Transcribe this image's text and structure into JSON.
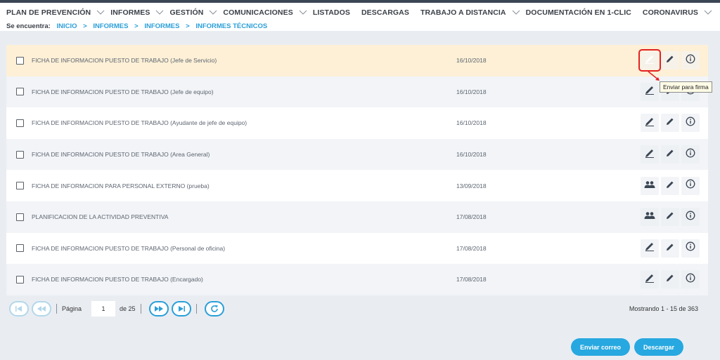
{
  "nav": {
    "items": [
      {
        "label": "PLAN DE PREVENCIÓN",
        "dropdown": true
      },
      {
        "label": "INFORMES",
        "dropdown": true
      },
      {
        "label": "GESTIÓN",
        "dropdown": true
      },
      {
        "label": "COMUNICACIONES",
        "dropdown": true
      },
      {
        "label": "LISTADOS",
        "dropdown": false
      },
      {
        "label": "DESCARGAS",
        "dropdown": false
      },
      {
        "label": "TRABAJO A DISTANCIA",
        "dropdown": true
      },
      {
        "label": "DOCUMENTACIÓN EN 1-CLIC",
        "dropdown": false
      },
      {
        "label": "CORONAVIRUS",
        "dropdown": true
      }
    ]
  },
  "breadcrumb": {
    "label": "Se encuentra:",
    "links": [
      "INICIO",
      "INFORMES",
      "INFORMES",
      "INFORMES TÉCNICOS"
    ],
    "separator": ">"
  },
  "rows": [
    {
      "title": "FICHA DE INFORMACION PUESTO DE TRABAJO (Jefe de Servicio)",
      "date": "16/10/2018",
      "first_icon": "sign-icon"
    },
    {
      "title": "FICHA DE INFORMACION PUESTO DE TRABAJO (Jefe de equipo)",
      "date": "16/10/2018",
      "first_icon": "sign-icon"
    },
    {
      "title": "FICHA DE INFORMACION PUESTO DE TRABAJO (Ayudante de jefe de equipo)",
      "date": "16/10/2018",
      "first_icon": "sign-icon"
    },
    {
      "title": "FICHA DE INFORMACION PUESTO DE TRABAJO (Area General)",
      "date": "16/10/2018",
      "first_icon": "sign-icon"
    },
    {
      "title": "FICHA DE INFORMACION PARA PERSONAL EXTERNO (prueba)",
      "date": "13/09/2018",
      "first_icon": "people-icon"
    },
    {
      "title": "PLANIFICACION DE LA ACTIVIDAD PREVENTIVA",
      "date": "17/08/2018",
      "first_icon": "people-icon"
    },
    {
      "title": "FICHA DE INFORMACION PUESTO DE TRABAJO (Personal de oficina)",
      "date": "17/08/2018",
      "first_icon": "sign-icon"
    },
    {
      "title": "FICHA DE INFORMACION PUESTO DE TRABAJO (Encargado)",
      "date": "17/08/2018",
      "first_icon": "sign-icon"
    }
  ],
  "tooltip": {
    "text": "Enviar para firma"
  },
  "pager": {
    "page_label": "Página",
    "page_value": "1",
    "of_label": "de 25",
    "showing": "Mostrando 1 - 15 de 363"
  },
  "buttons": {
    "send_mail": "Enviar correo",
    "download": "Descargar"
  },
  "colors": {
    "accent": "#27a8e0",
    "dark": "#3b4654",
    "highlight": "#e32222",
    "selected_row": "#fdf0d6"
  }
}
